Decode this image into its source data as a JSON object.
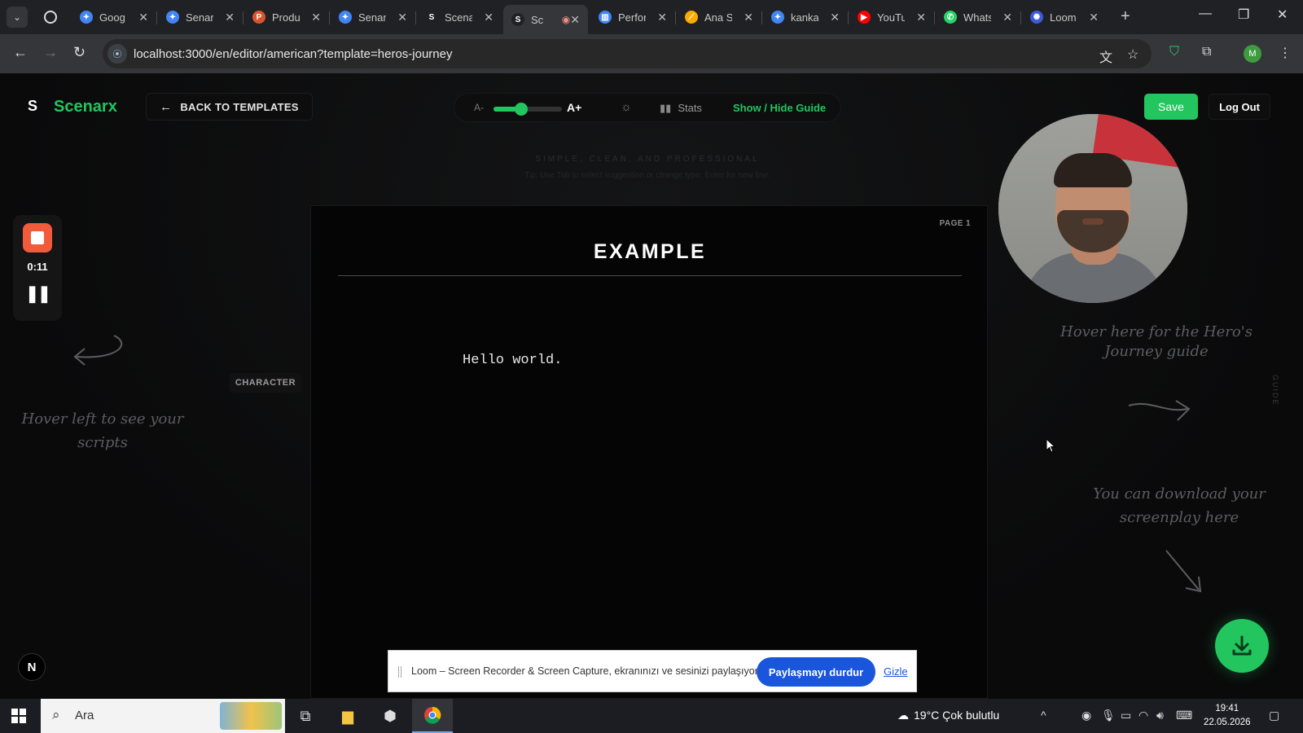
{
  "browser": {
    "tabs": [
      {
        "title": "Goog",
        "fav_color": "#4285f4",
        "fav_glyph": "✦"
      },
      {
        "title": "Senar",
        "fav_color": "#4285f4",
        "fav_glyph": "✦"
      },
      {
        "title": "Produ",
        "fav_color": "#da552f",
        "fav_glyph": "P"
      },
      {
        "title": "Senar",
        "fav_color": "#4285f4",
        "fav_glyph": "✦"
      },
      {
        "title": "Scena",
        "fav_color": "#202124",
        "fav_glyph": "S"
      },
      {
        "title": "Sc",
        "fav_color": "#202124",
        "fav_glyph": "S",
        "active": true
      },
      {
        "title": "Perfor",
        "fav_color": "#4285f4",
        "fav_glyph": "▥"
      },
      {
        "title": "Ana S",
        "fav_color": "#f9ab00",
        "fav_glyph": "⟋"
      },
      {
        "title": "kanka",
        "fav_color": "#4285f4",
        "fav_glyph": "✦"
      },
      {
        "title": "YouTu",
        "fav_color": "#ff0000",
        "fav_glyph": "▶"
      },
      {
        "title": "Whats",
        "fav_color": "#25d366",
        "fav_glyph": "✆"
      },
      {
        "title": "Loom",
        "fav_color": "#3b5bdb",
        "fav_glyph": "✺"
      }
    ],
    "url": "localhost:3000/en/editor/american?template=heros-journey"
  },
  "app": {
    "logo_mark": "S",
    "logo_text": "Scenarx",
    "back_label": "BACK TO TEMPLATES",
    "font_smaller": "A-",
    "font_larger": "A+",
    "font_size_level": 0.4,
    "stats_label": "Stats",
    "guide_toggle": "Show / Hide Guide",
    "save_label": "Save",
    "logout_label": "Log Out",
    "tagline": "SIMPLE, CLEAN, AND PROFESSIONAL",
    "hint": "Tip: Use Tab to select suggestion or change type, Enter for new line.",
    "accent": "#22c55e"
  },
  "recorder": {
    "time": "0:11"
  },
  "script_page": {
    "page_label": "PAGE 1",
    "title": "EXAMPLE",
    "element_type": "CHARACTER",
    "line": "Hello world."
  },
  "hints": {
    "left": "Hover left to see your scripts",
    "guide": "Hover here for the Hero's Journey guide",
    "download": "You can download your screenplay here",
    "guide_tab": "GUIDE"
  },
  "loom_bar": {
    "message": "Loom – Screen Recorder & Screen Capture, ekranınızı ve sesinizi paylaşıyor.",
    "stop_label": "Paylaşmayı durdur",
    "hide_label": "Gizle"
  },
  "taskbar": {
    "search_placeholder": "Ara",
    "weather": "19°C  Çok bulutlu",
    "time": "19:41",
    "date": "22.05.2026"
  }
}
